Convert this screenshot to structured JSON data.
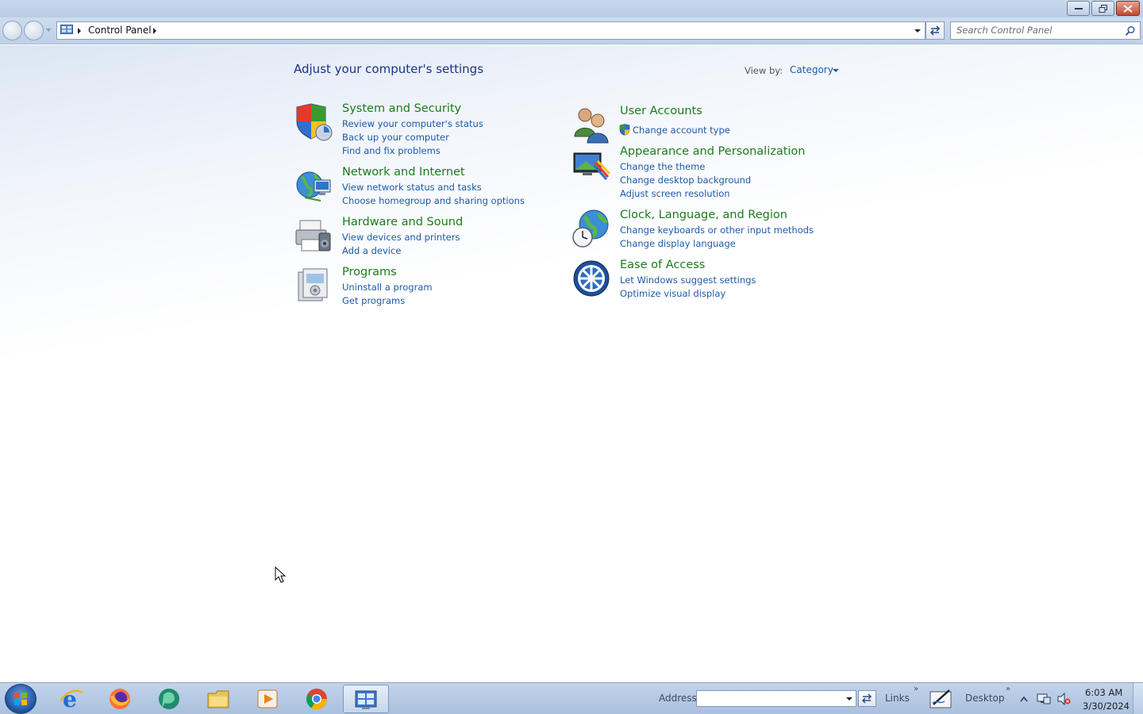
{
  "address": {
    "breadcrumb": "Control Panel"
  },
  "search": {
    "placeholder": "Search Control Panel"
  },
  "header": {
    "title": "Adjust your computer's settings",
    "view_by_label": "View by:",
    "view_by_value": "Category"
  },
  "categories_left": [
    {
      "title": "System and Security",
      "links": [
        "Review your computer's status",
        "Back up your computer",
        "Find and fix problems"
      ],
      "icon": "shield-icon"
    },
    {
      "title": "Network and Internet",
      "links": [
        "View network status and tasks",
        "Choose homegroup and sharing options"
      ],
      "icon": "network-globe-icon"
    },
    {
      "title": "Hardware and Sound",
      "links": [
        "View devices and printers",
        "Add a device"
      ],
      "icon": "printer-icon"
    },
    {
      "title": "Programs",
      "links": [
        "Uninstall a program",
        "Get programs"
      ],
      "icon": "programs-icon"
    }
  ],
  "categories_right": [
    {
      "title": "User Accounts",
      "links": [
        "Change account type"
      ],
      "icon": "users-icon"
    },
    {
      "title": "Appearance and Personalization",
      "links": [
        "Change the theme",
        "Change desktop background",
        "Adjust screen resolution"
      ],
      "icon": "monitor-paint-icon"
    },
    {
      "title": "Clock, Language, and Region",
      "links": [
        "Change keyboards or other input methods",
        "Change display language"
      ],
      "icon": "globe-clock-icon"
    },
    {
      "title": "Ease of Access",
      "links": [
        "Let Windows suggest settings",
        "Optimize visual display"
      ],
      "icon": "ease-of-access-icon"
    }
  ],
  "taskbar": {
    "address_label": "Address",
    "links_label": "Links",
    "desktop_label": "Desktop",
    "time": "6:03 AM",
    "date": "3/30/2024",
    "apps": [
      "internet-explorer-icon",
      "firefox-icon",
      "green-app-icon",
      "file-explorer-icon",
      "media-player-icon",
      "chrome-icon",
      "control-panel-icon"
    ]
  },
  "colors": {
    "category_title": "#1e7a1e",
    "link": "#1e5aa8",
    "page_title": "#1e3287"
  }
}
